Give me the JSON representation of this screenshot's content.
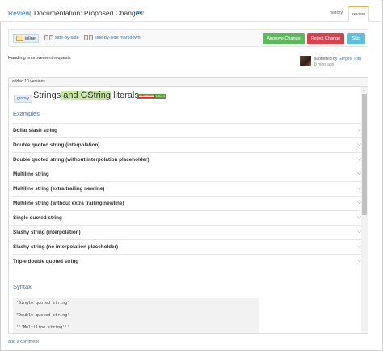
{
  "header": {
    "review_link": "Review",
    "separator": "|",
    "page_title": "Documentation: Proposed Changes",
    "filter_link": "filter",
    "tabs": [
      {
        "label": "history"
      },
      {
        "label": "review"
      }
    ]
  },
  "toolbar": {
    "view_options": [
      {
        "label": "inline"
      },
      {
        "label": "side-by-side"
      },
      {
        "label": "side-by-side markdown"
      }
    ],
    "approve_label": "Approve Change",
    "reject_label": "Reject Change",
    "skip_label": "Skip"
  },
  "request": {
    "description": "Handling improvement requests",
    "submitted_by_label": "submitted by",
    "user": "Gergely Toth",
    "time": "8 mins ago"
  },
  "panel": {
    "header": "added 10 versions",
    "tag": "groovy",
    "title_pre": "Strings",
    "title_hl": " and GString",
    "title_post": " literals",
    "version_badge_old": "All Versions",
    "version_badge_new": "1.5-2.4",
    "examples_heading": "Examples",
    "examples": [
      {
        "label": "Dollar slash string"
      },
      {
        "label": "Double quoted string (interpolation)"
      },
      {
        "label": "Double quoted string (without interpolation placeholder)"
      },
      {
        "label": "Multiline string"
      },
      {
        "label": "Multiline string (extra trailing newline)"
      },
      {
        "label": "Multiline string (without extra trailing newline)"
      },
      {
        "label": "Single quoted string"
      },
      {
        "label": "Slashy string (interpolation)"
      },
      {
        "label": "Slashy string (no interpolation placeholder)"
      },
      {
        "label": "Triple double quoted string"
      }
    ],
    "chevron": "⌵",
    "syntax_heading": "Syntax",
    "syntax_lines": [
      "'Single quoted string'",
      "\"Double quoted string\"",
      "'''Multiline string'''"
    ]
  },
  "footer": {
    "add_comment": "add a comment"
  }
}
